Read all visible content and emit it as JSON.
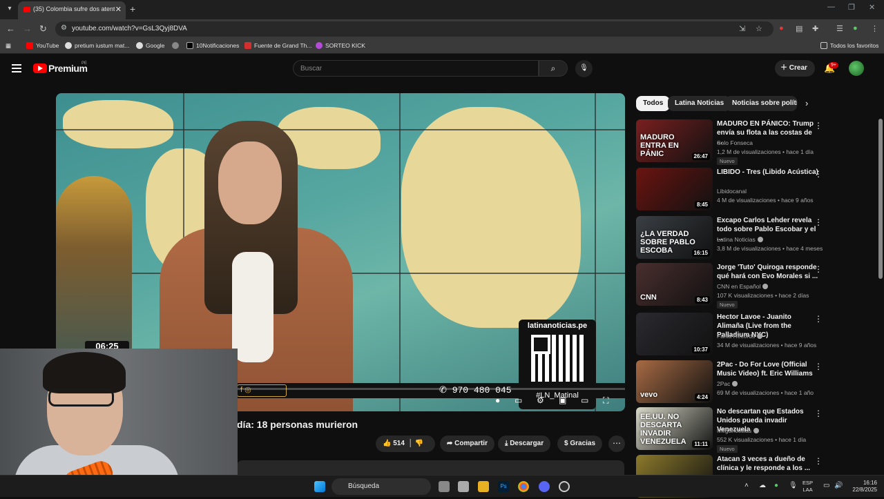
{
  "browser": {
    "tab_title": "(35) Colombia sufre dos atenta",
    "url": "youtube.com/watch?v=GsL3Qyj8DVA",
    "bookmarks": [
      "YouTube",
      "pretium iustum mat...",
      "Google",
      "10Notificaciones",
      "Fuente de Grand Th...",
      "SORTEO KICK"
    ],
    "all_bookmarks": "Todos los favoritos"
  },
  "youtube": {
    "logo_text": "Premium",
    "country": "PE",
    "search_placeholder": "Buscar",
    "create_label": "Crear",
    "notif_badge": "9+"
  },
  "video": {
    "title_partial": "día: 18 personas murieron",
    "overlay_site": "latinanoticias.pe",
    "overlay_tag": "#LN_Matinal",
    "overlay_phone": "970 480 045",
    "overlay_clock": "06:25",
    "likes": "514",
    "share_label": "Compartir",
    "download_label": "Descargar",
    "thanks_label": "Gracias"
  },
  "chips": [
    "Todos",
    "Latina Noticias",
    "Noticias sobre política"
  ],
  "recommendations": [
    {
      "title": "MADURO EN PÁNICO: Trump envía su flota a las costas de ...",
      "channel": "Solo Fonseca",
      "views": "1,2 M de visualizaciones",
      "age": "hace 1 día",
      "duration": "26:47",
      "badge": "Nuevo",
      "verified": false,
      "thumb_text": "MADURO ENTRA EN PÁNIC",
      "thumb_bg": "#7a1f1f"
    },
    {
      "title": "LIBIDO - Tres (Libido Acústica)",
      "channel": "Libidocanal",
      "views": "4 M de visualizaciones",
      "age": "hace 9 años",
      "duration": "8:45",
      "badge": "",
      "verified": false,
      "thumb_text": "",
      "thumb_bg": "#6b1410"
    },
    {
      "title": "Excapo Carlos Lehder revela todo sobre Pablo Escobar y el ...",
      "channel": "Latina Noticias",
      "views": "3,8 M de visualizaciones",
      "age": "hace 4 meses",
      "duration": "16:15",
      "badge": "",
      "verified": true,
      "thumb_text": "¿LA VERDAD SOBRE PABLO ESCOBA",
      "thumb_bg": "#3a3f44"
    },
    {
      "title": "Jorge 'Tuto' Quiroga responde qué hará con Evo Morales si ...",
      "channel": "CNN en Español",
      "views": "107 K visualizaciones",
      "age": "hace 2 días",
      "duration": "8:43",
      "badge": "Nuevo",
      "verified": true,
      "thumb_text": "CNN",
      "thumb_bg": "#4a2e2e"
    },
    {
      "title": "Hector Lavoe - Juanito Alimaña (Live from the Palladium NYC)",
      "channel": "Fania Records",
      "views": "34 M de visualizaciones",
      "age": "hace 9 años",
      "duration": "10:37",
      "badge": "",
      "verified": true,
      "thumb_text": "",
      "thumb_bg": "#2a2a30"
    },
    {
      "title": "2Pac - Do For Love (Official Music Video) ft. Eric Williams",
      "channel": "2Pac",
      "views": "69 M de visualizaciones",
      "age": "hace 1 año",
      "duration": "4:24",
      "badge": "",
      "verified": true,
      "thumb_text": "vevo",
      "thumb_bg": "#a86b44"
    },
    {
      "title": "No descartan que Estados Unidos pueda invadir Venezuela",
      "channel": "Meganoticias",
      "views": "552 K visualizaciones",
      "age": "hace 1 día",
      "duration": "11:11",
      "badge": "Nuevo",
      "verified": true,
      "thumb_text": "EE.UU. NO DESCARTA INVADIR VENEZUELA",
      "thumb_bg": "#d8d8c8"
    },
    {
      "title": "Atacan 3 veces a dueño de clínica y le responde a los ...",
      "channel": "",
      "views": "",
      "age": "",
      "duration": "",
      "badge": "",
      "verified": false,
      "thumb_text": "",
      "thumb_bg": "#8c7a2c"
    }
  ],
  "taskbar": {
    "search_label": "Búsqueda",
    "lang_top": "ESP",
    "lang_bottom": "LAA",
    "time": "16:16",
    "date": "22/8/2025"
  },
  "colors": {
    "yt_red": "#ff0000",
    "chip_bg": "#272727",
    "bg": "#0f0f0f"
  }
}
